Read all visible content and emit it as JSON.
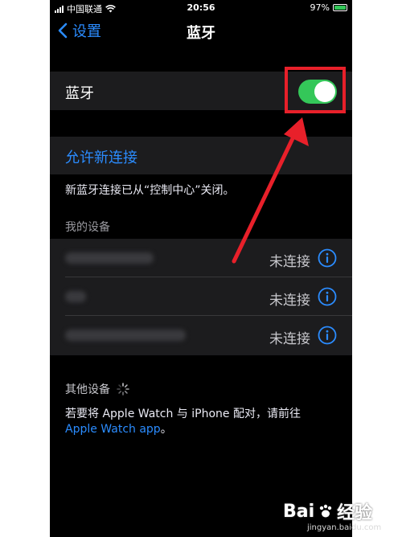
{
  "status_bar": {
    "carrier": "中国联通",
    "time": "20:56",
    "battery": "97%",
    "battery_level": 0.97
  },
  "nav": {
    "back_label": "设置",
    "title": "蓝牙"
  },
  "bluetooth": {
    "label": "蓝牙",
    "enabled": true
  },
  "allow_new": {
    "label": "允许新连接",
    "note": "新蓝牙连接已从“控制中心”关闭。"
  },
  "my_devices": {
    "header": "我的设备",
    "items": [
      {
        "status": "未连接"
      },
      {
        "status": "未连接"
      },
      {
        "status": "未连接"
      }
    ]
  },
  "other_devices": {
    "header": "其他设备",
    "note": "若要将 Apple Watch 与 iPhone 配对，请前往",
    "link": "Apple Watch app",
    "suffix": "。"
  },
  "watermark": {
    "brand": "Bai",
    "brand2": "经验",
    "url": "jingyan.baidu.com"
  },
  "colors": {
    "accent": "#2b8cff",
    "toggle_on": "#34c759",
    "annotation": "#e8202a"
  }
}
